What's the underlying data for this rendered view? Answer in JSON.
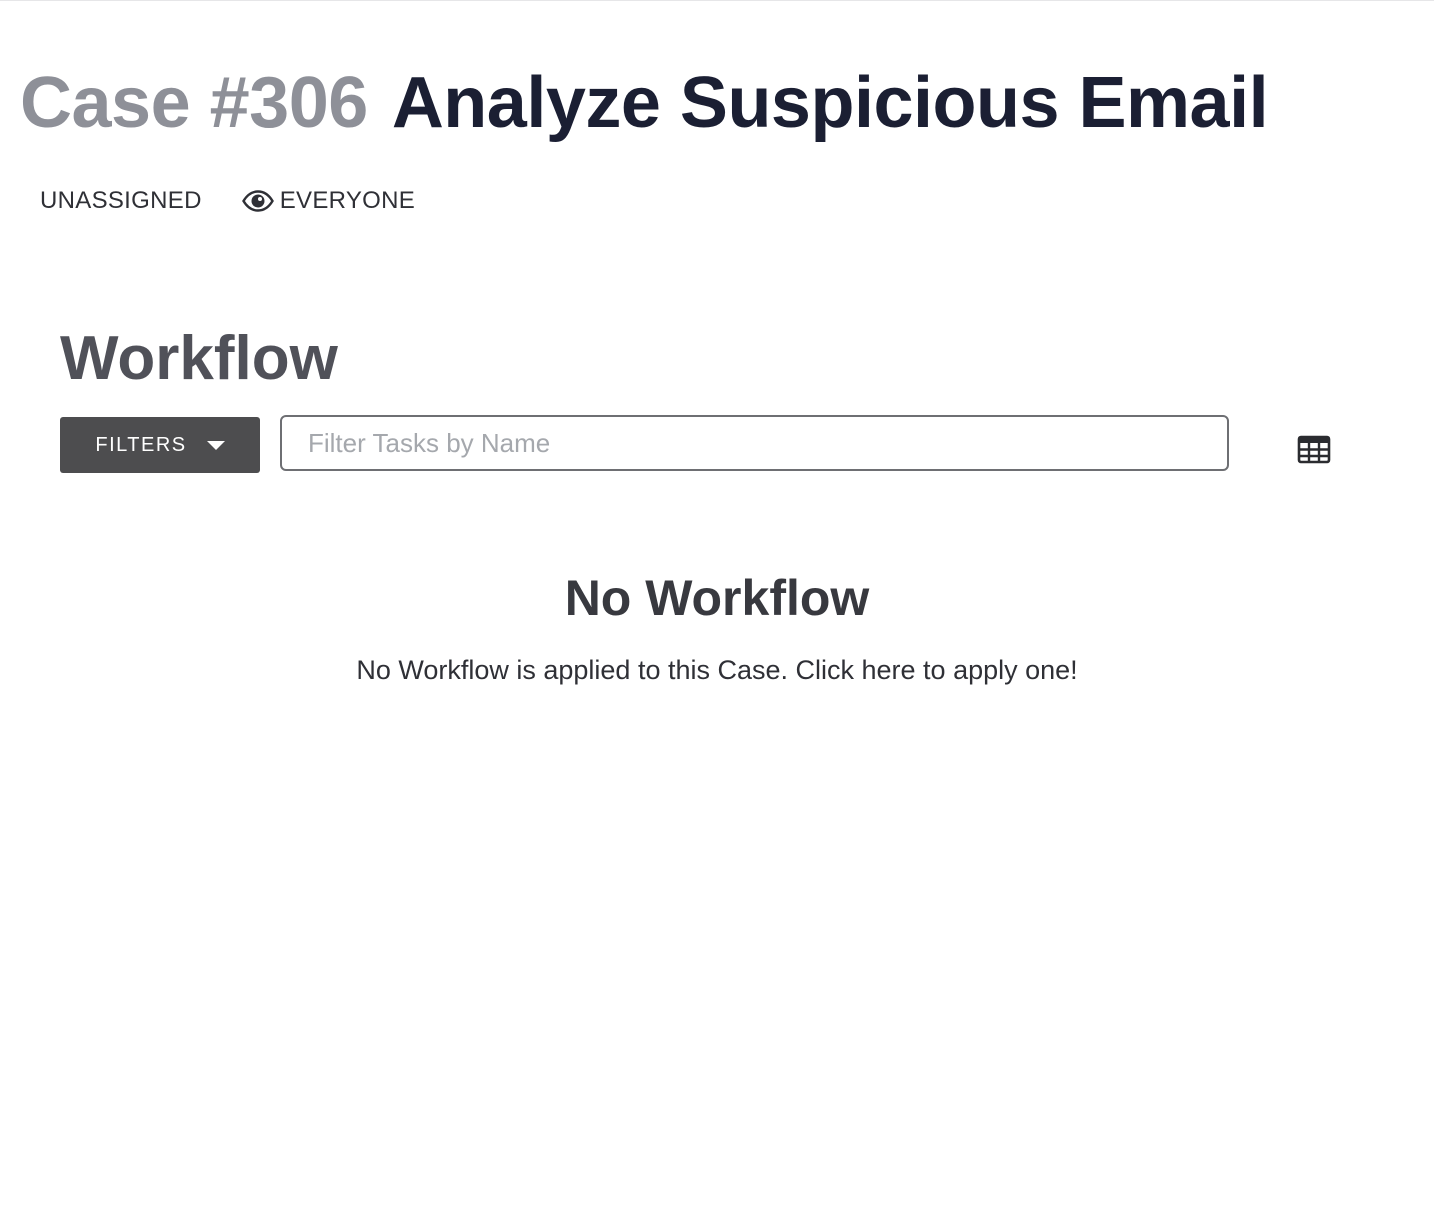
{
  "case": {
    "number": "Case #306",
    "title": "Analyze Suspicious Email",
    "assignee": "UNASSIGNED",
    "visibility": "EVERYONE",
    "visibility_icon": "eye-icon"
  },
  "workflow": {
    "heading": "Workflow",
    "filters_label": "FILTERS",
    "filters_icon": "caret-down-icon",
    "search_placeholder": "Filter Tasks by Name",
    "search_value": "",
    "view_toggle_icon": "table-grid-icon"
  },
  "empty_state": {
    "title": "No Workflow",
    "message": "No Workflow is applied to this Case. Click here to apply one!"
  },
  "colors": {
    "case_number": "#8e9098",
    "case_title": "#1b1f33",
    "filters_button_bg": "#4d4d4f",
    "heading": "#505159"
  }
}
